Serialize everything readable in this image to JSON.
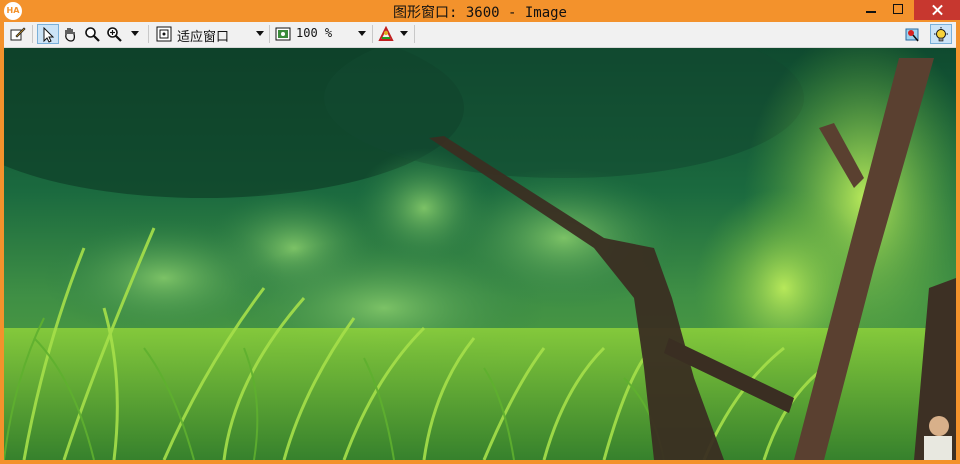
{
  "window": {
    "title": "图形窗口: 3600 - Image",
    "app_icon_text": "HA"
  },
  "toolbar": {
    "zoom_mode_label": "适应窗口",
    "zoom_percent": "100 %"
  },
  "icons": {
    "edit": "pencil-edit-icon",
    "pointer": "pointer-arrow-icon",
    "pan": "hand-pan-icon",
    "zoom": "magnifier-icon",
    "zoom_plus": "magnifier-plus-icon",
    "fit": "fit-window-icon",
    "zoom_percent": "zoom-percent-icon",
    "color": "color-palette-icon",
    "map": "map-pin-icon",
    "bulb": "light-bulb-icon"
  },
  "colors": {
    "window_frame": "#f3922c",
    "close_button": "#c7372f",
    "toolbar_bg": "#f1f1f1",
    "active_tool": "#cce4f7"
  },
  "image": {
    "description_scene": "forest"
  }
}
